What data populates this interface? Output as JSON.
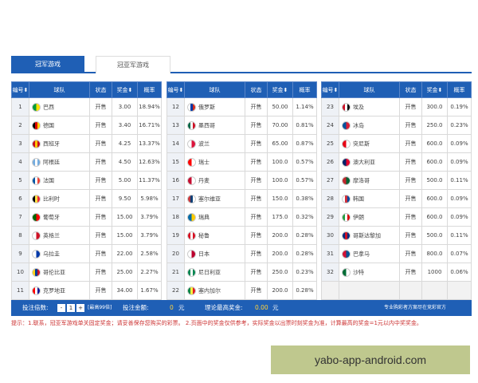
{
  "tabs": [
    {
      "label": "冠军游戏",
      "active": true
    },
    {
      "label": "冠亚军游戏",
      "active": false
    }
  ],
  "table_headers": {
    "no": "编号⬍",
    "team": "球队",
    "status": "状态",
    "prize": "奖金⬍",
    "prob": "概率"
  },
  "groups": [
    {
      "rows": [
        {
          "no": "1",
          "team": "巴西",
          "status": "开售",
          "prize": "3.00",
          "prob": "18.94%",
          "flag": "brazil-flag-icon",
          "colors": [
            "#009b3a",
            "#fedf00"
          ]
        },
        {
          "no": "2",
          "team": "德国",
          "status": "开售",
          "prize": "3.40",
          "prob": "16.71%",
          "flag": "germany-flag-icon",
          "colors": [
            "#000000",
            "#dd0000",
            "#ffce00"
          ]
        },
        {
          "no": "3",
          "team": "西班牙",
          "status": "开售",
          "prize": "4.25",
          "prob": "13.37%",
          "flag": "spain-flag-icon",
          "colors": [
            "#c60b1e",
            "#ffc400",
            "#c60b1e"
          ]
        },
        {
          "no": "4",
          "team": "阿根廷",
          "status": "开售",
          "prize": "4.50",
          "prob": "12.63%",
          "flag": "argentina-flag-icon",
          "colors": [
            "#74acdf",
            "#ffffff",
            "#74acdf"
          ]
        },
        {
          "no": "5",
          "team": "法国",
          "status": "开售",
          "prize": "5.00",
          "prob": "11.37%",
          "flag": "france-flag-icon",
          "colors": [
            "#0055a4",
            "#ffffff",
            "#ef4135"
          ]
        },
        {
          "no": "6",
          "team": "比利时",
          "status": "开售",
          "prize": "9.50",
          "prob": "5.98%",
          "flag": "belgium-flag-icon",
          "colors": [
            "#000000",
            "#fae042",
            "#ed2939"
          ]
        },
        {
          "no": "7",
          "team": "葡萄牙",
          "status": "开售",
          "prize": "15.00",
          "prob": "3.79%",
          "flag": "portugal-flag-icon",
          "colors": [
            "#006600",
            "#ff0000"
          ]
        },
        {
          "no": "8",
          "team": "英格兰",
          "status": "开售",
          "prize": "15.00",
          "prob": "3.79%",
          "flag": "england-flag-icon",
          "colors": [
            "#ffffff",
            "#ce1124"
          ]
        },
        {
          "no": "9",
          "team": "乌拉圭",
          "status": "开售",
          "prize": "22.00",
          "prob": "2.58%",
          "flag": "uruguay-flag-icon",
          "colors": [
            "#ffffff",
            "#0038a8"
          ]
        },
        {
          "no": "10",
          "team": "哥伦比亚",
          "status": "开售",
          "prize": "25.00",
          "prob": "2.27%",
          "flag": "colombia-flag-icon",
          "colors": [
            "#fcd116",
            "#003893",
            "#ce1126"
          ]
        },
        {
          "no": "11",
          "team": "克罗地亚",
          "status": "开售",
          "prize": "34.00",
          "prob": "1.67%",
          "flag": "croatia-flag-icon",
          "colors": [
            "#ff0000",
            "#ffffff",
            "#171796"
          ]
        }
      ]
    },
    {
      "rows": [
        {
          "no": "12",
          "team": "俄罗斯",
          "status": "开售",
          "prize": "50.00",
          "prob": "1.14%",
          "flag": "russia-flag-icon",
          "colors": [
            "#ffffff",
            "#0039a6",
            "#d52b1e"
          ]
        },
        {
          "no": "13",
          "team": "墨西哥",
          "status": "开售",
          "prize": "70.00",
          "prob": "0.81%",
          "flag": "mexico-flag-icon",
          "colors": [
            "#006847",
            "#ffffff",
            "#ce1126"
          ]
        },
        {
          "no": "14",
          "team": "波兰",
          "status": "开售",
          "prize": "65.00",
          "prob": "0.87%",
          "flag": "poland-flag-icon",
          "colors": [
            "#ffffff",
            "#dc143c"
          ]
        },
        {
          "no": "15",
          "team": "瑞士",
          "status": "开售",
          "prize": "100.0",
          "prob": "0.57%",
          "flag": "switzerland-flag-icon",
          "colors": [
            "#ff0000",
            "#ffffff"
          ]
        },
        {
          "no": "16",
          "team": "丹麦",
          "status": "开售",
          "prize": "100.0",
          "prob": "0.57%",
          "flag": "denmark-flag-icon",
          "colors": [
            "#c60c30",
            "#ffffff"
          ]
        },
        {
          "no": "17",
          "team": "塞尔维亚",
          "status": "开售",
          "prize": "150.0",
          "prob": "0.38%",
          "flag": "serbia-flag-icon",
          "colors": [
            "#c6363c",
            "#0c4076",
            "#ffffff"
          ]
        },
        {
          "no": "18",
          "team": "瑞典",
          "status": "开售",
          "prize": "175.0",
          "prob": "0.32%",
          "flag": "sweden-flag-icon",
          "colors": [
            "#006aa7",
            "#fecc00"
          ]
        },
        {
          "no": "19",
          "team": "秘鲁",
          "status": "开售",
          "prize": "200.0",
          "prob": "0.28%",
          "flag": "peru-flag-icon",
          "colors": [
            "#d91023",
            "#ffffff",
            "#d91023"
          ]
        },
        {
          "no": "20",
          "team": "日本",
          "status": "开售",
          "prize": "200.0",
          "prob": "0.28%",
          "flag": "japan-flag-icon",
          "colors": [
            "#ffffff",
            "#bc002d"
          ]
        },
        {
          "no": "21",
          "team": "尼日利亚",
          "status": "开售",
          "prize": "250.0",
          "prob": "0.23%",
          "flag": "nigeria-flag-icon",
          "colors": [
            "#008751",
            "#ffffff",
            "#008751"
          ]
        },
        {
          "no": "22",
          "team": "塞内加尔",
          "status": "开售",
          "prize": "200.0",
          "prob": "0.28%",
          "flag": "senegal-flag-icon",
          "colors": [
            "#00853f",
            "#fdef42",
            "#e31b23"
          ]
        }
      ]
    },
    {
      "rows": [
        {
          "no": "23",
          "team": "埃及",
          "status": "开售",
          "prize": "300.0",
          "prob": "0.19%",
          "flag": "egypt-flag-icon",
          "colors": [
            "#ce1126",
            "#ffffff",
            "#000000"
          ]
        },
        {
          "no": "24",
          "team": "冰岛",
          "status": "开售",
          "prize": "250.0",
          "prob": "0.23%",
          "flag": "iceland-flag-icon",
          "colors": [
            "#02529c",
            "#dc1e35"
          ]
        },
        {
          "no": "25",
          "team": "突尼斯",
          "status": "开售",
          "prize": "600.0",
          "prob": "0.09%",
          "flag": "tunisia-flag-icon",
          "colors": [
            "#e70013",
            "#ffffff"
          ]
        },
        {
          "no": "26",
          "team": "澳大利亚",
          "status": "开售",
          "prize": "600.0",
          "prob": "0.09%",
          "flag": "australia-flag-icon",
          "colors": [
            "#012169",
            "#e4002b"
          ]
        },
        {
          "no": "27",
          "team": "摩洛哥",
          "status": "开售",
          "prize": "500.0",
          "prob": "0.11%",
          "flag": "morocco-flag-icon",
          "colors": [
            "#c1272d",
            "#006233"
          ]
        },
        {
          "no": "28",
          "team": "韩国",
          "status": "开售",
          "prize": "600.0",
          "prob": "0.09%",
          "flag": "south-korea-flag-icon",
          "colors": [
            "#ffffff",
            "#cd2e3a",
            "#0047a0"
          ]
        },
        {
          "no": "29",
          "team": "伊朗",
          "status": "开售",
          "prize": "600.0",
          "prob": "0.09%",
          "flag": "iran-flag-icon",
          "colors": [
            "#239f40",
            "#ffffff",
            "#da0000"
          ]
        },
        {
          "no": "30",
          "team": "哥斯达黎加",
          "status": "开售",
          "prize": "500.0",
          "prob": "0.11%",
          "flag": "costa-rica-flag-icon",
          "colors": [
            "#002b7f",
            "#ce1126",
            "#002b7f"
          ]
        },
        {
          "no": "31",
          "team": "巴拿马",
          "status": "开售",
          "prize": "800.0",
          "prob": "0.07%",
          "flag": "panama-flag-icon",
          "colors": [
            "#d21034",
            "#005293"
          ]
        },
        {
          "no": "32",
          "team": "沙特",
          "status": "开售",
          "prize": "1000",
          "prob": "0.06%",
          "flag": "saudi-arabia-flag-icon",
          "colors": [
            "#006c35",
            "#ffffff"
          ]
        }
      ]
    }
  ],
  "footer": {
    "multiplier_label": "投注倍数:",
    "minus_label": "-",
    "multiplier_value": "1",
    "plus_label": "+",
    "max_note": "[最高99倍]",
    "amount_label": "投注金额:",
    "amount_value": "0",
    "amount_unit": "元",
    "max_prize_label": "理论最高奖金:",
    "max_prize_value": "0.00",
    "max_prize_unit": "元",
    "right_note": "专业购彩者方案尽在竞彩官方"
  },
  "hint_text": "提示：1.联系，冠亚军游戏单关固定奖金；请妥善保存您购买的彩票。  2.页面中的奖金仅供参考，实际奖金以出票时刻奖金为准，计算最高的奖金=1元以内中奖奖金。",
  "watermark": "yabo-app-android.com",
  "colors": {
    "header_blue": "#1f5fb5",
    "highlight_yellow": "#ffd23c"
  }
}
